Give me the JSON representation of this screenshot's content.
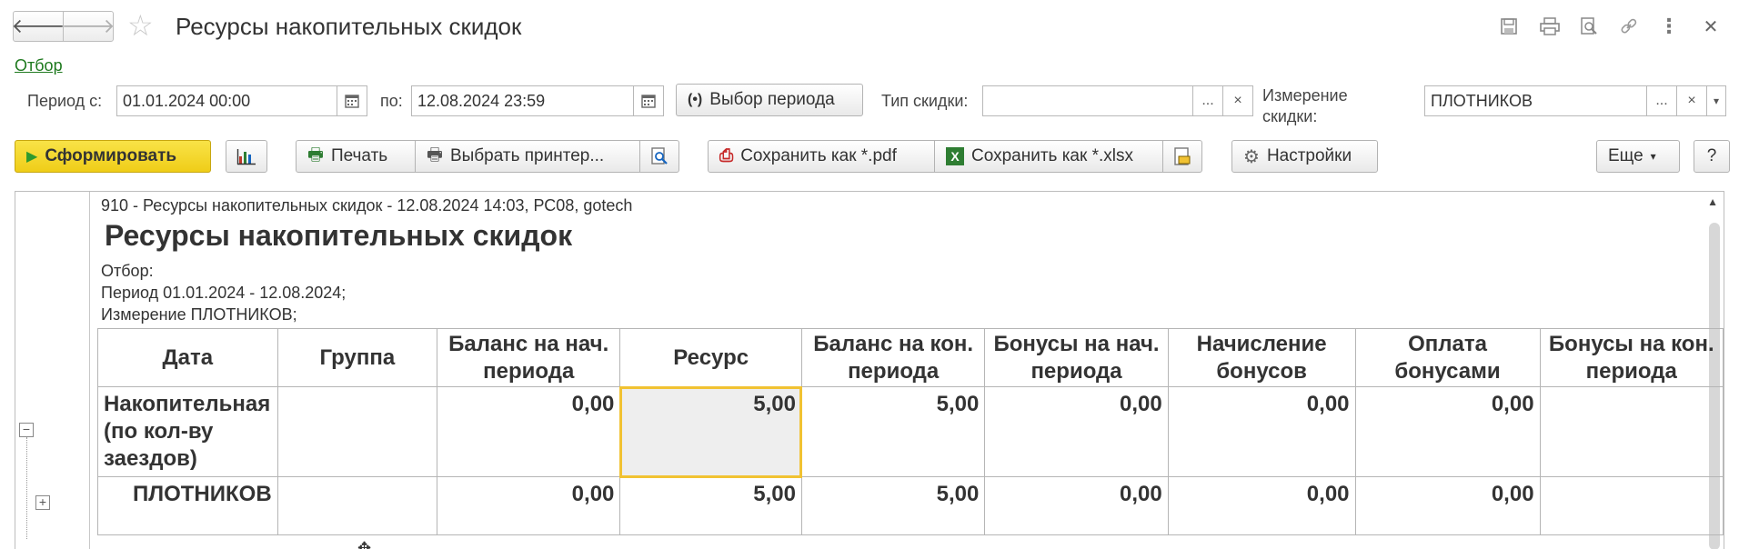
{
  "window": {
    "title": "Ресурсы накопительных скидок",
    "back_icon": "arrow-left-icon",
    "forward_icon": "arrow-right-icon",
    "favorite_icon": "star-icon",
    "tool_icons": [
      "save-icon",
      "print-icon",
      "preview-icon",
      "link-icon",
      "more-icon",
      "close-icon"
    ]
  },
  "filter_link": "Отбор",
  "filters": {
    "period_from_label": "Период с:",
    "period_from_value": "01.01.2024 00:00",
    "period_to_label": "по:",
    "period_to_value": "12.08.2024 23:59",
    "choose_period_label": "Выбор периода",
    "discount_type_label": "Тип скидки:",
    "discount_type_value": "",
    "dimension_label_line1": "Измерение",
    "dimension_label_line2": "скидки:",
    "dimension_value": "ПЛОТНИКОВ",
    "select_btn": "...",
    "clear_btn": "×"
  },
  "toolbar": {
    "generate_label": "Сформировать",
    "print_label": "Печать",
    "choose_printer_label": "Выбрать принтер...",
    "save_pdf_label": "Сохранить как *.pdf",
    "save_xlsx_label": "Сохранить как *.xlsx",
    "settings_label": "Настройки",
    "more_label": "Еще",
    "help_label": "?"
  },
  "report": {
    "meta": "910 - Ресурсы накопительных скидок - 12.08.2024 14:03, РС08, gotech",
    "title": "Ресурсы накопительных скидок",
    "filter_caption": "Отбор:",
    "filter_period": "Период 01.01.2024 - 12.08.2024;",
    "filter_dimension": "Измерение ПЛОТНИКОВ;",
    "columns": [
      "Дата",
      "Группа",
      "Баланс на нач. периода",
      "Ресурс",
      "Баланс на кон. периода",
      "Бонусы на нач. периода",
      "Начисление бонусов",
      "Оплата бонусами",
      "Бонусы на кон. периода"
    ],
    "rows": [
      {
        "name": "Накопительная (по кол-ву заездов)",
        "group": "",
        "values": [
          "0,00",
          "5,00",
          "5,00",
          "0,00",
          "0,00",
          "0,00",
          ""
        ]
      },
      {
        "name": "ПЛОТНИКОВ",
        "group": "",
        "values": [
          "0,00",
          "5,00",
          "5,00",
          "0,00",
          "0,00",
          "0,00",
          ""
        ]
      }
    ]
  }
}
